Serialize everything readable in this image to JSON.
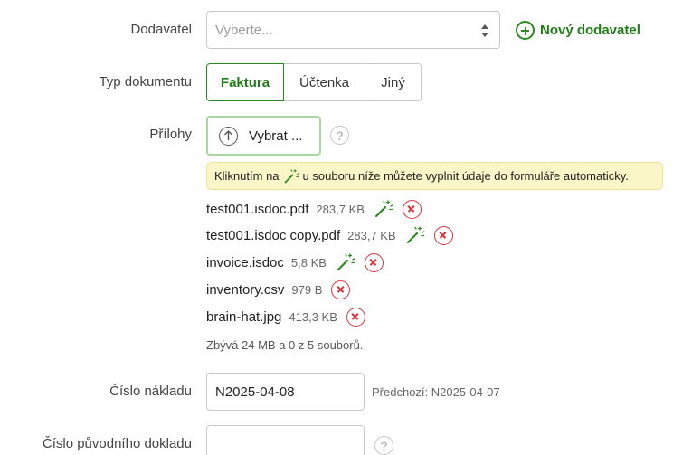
{
  "form": {
    "supplier": {
      "label": "Dodavatel",
      "placeholder": "Vyberte...",
      "new_button": "Nový dodavatel"
    },
    "doc_type": {
      "label": "Typ dokumentu",
      "options": [
        "Faktura",
        "Účtenka",
        "Jiný"
      ],
      "selected": "Faktura"
    },
    "attachments": {
      "label": "Přílohy",
      "upload_button": "Vybrat ...",
      "hint_before": "Kliknutím na",
      "hint_after": "u souboru níže můžete vyplnit údaje do formuláře automaticky.",
      "files": [
        {
          "name": "test001.isdoc.pdf",
          "size": "283,7 KB",
          "autofill": true
        },
        {
          "name": "test001.isdoc copy.pdf",
          "size": "283,7 KB",
          "autofill": true
        },
        {
          "name": "invoice.isdoc",
          "size": "5,8 KB",
          "autofill": true
        },
        {
          "name": "inventory.csv",
          "size": "979 B",
          "autofill": false
        },
        {
          "name": "brain-hat.jpg",
          "size": "413,3 KB",
          "autofill": false
        }
      ],
      "remaining": "Zbývá 24 MB a 0 z 5 souborů."
    },
    "expense_number": {
      "label": "Číslo nákladu",
      "value": "N2025-04-08",
      "previous": "Předchozí: N2025-04-07"
    },
    "original_doc_number": {
      "label": "Číslo původního dokladu",
      "value": ""
    }
  },
  "icons": {
    "help": "?",
    "upload": "upload-arrow-icon",
    "autofill": "magic-wand-icon",
    "remove": "remove-x-icon",
    "add": "plus-circle-icon"
  },
  "colors": {
    "accent_green": "#1e7d14",
    "remove_red": "#d9333a",
    "hint_bg": "#fbf6c8"
  }
}
